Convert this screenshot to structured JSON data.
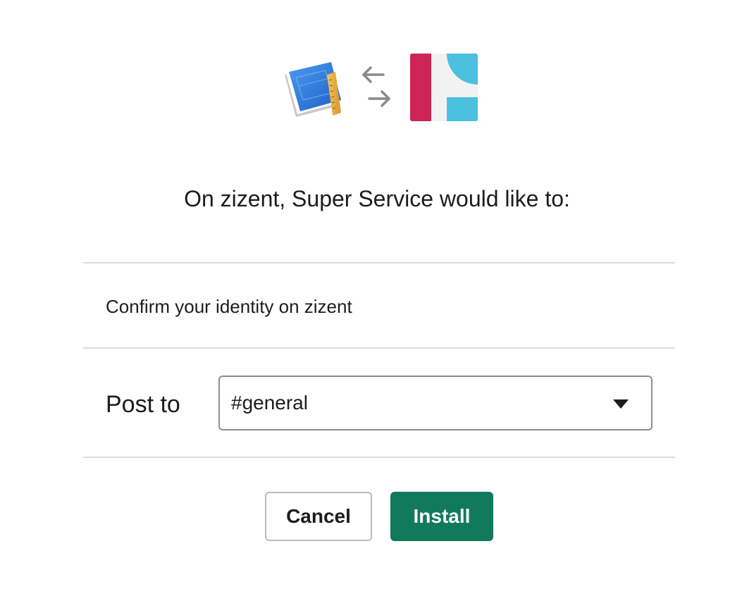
{
  "header": {
    "app_icon": "blueprint-book-icon",
    "exchange_icon": "exchange-arrows-icon",
    "workspace_icon": "zizent-workspace-icon"
  },
  "headline": "On zizent, Super Service would like to:",
  "permissions": [
    {
      "label": "Confirm your identity on zizent"
    }
  ],
  "post_to": {
    "label": "Post to",
    "selected_channel": "#general",
    "dropdown_icon": "caret-down-icon"
  },
  "actions": {
    "cancel_label": "Cancel",
    "install_label": "Install"
  },
  "colors": {
    "install_green": "#117a5c",
    "workspace_red": "#cd2556",
    "workspace_blue": "#4bc0e0",
    "divider": "#dddddd",
    "text": "#1d1c1d"
  }
}
